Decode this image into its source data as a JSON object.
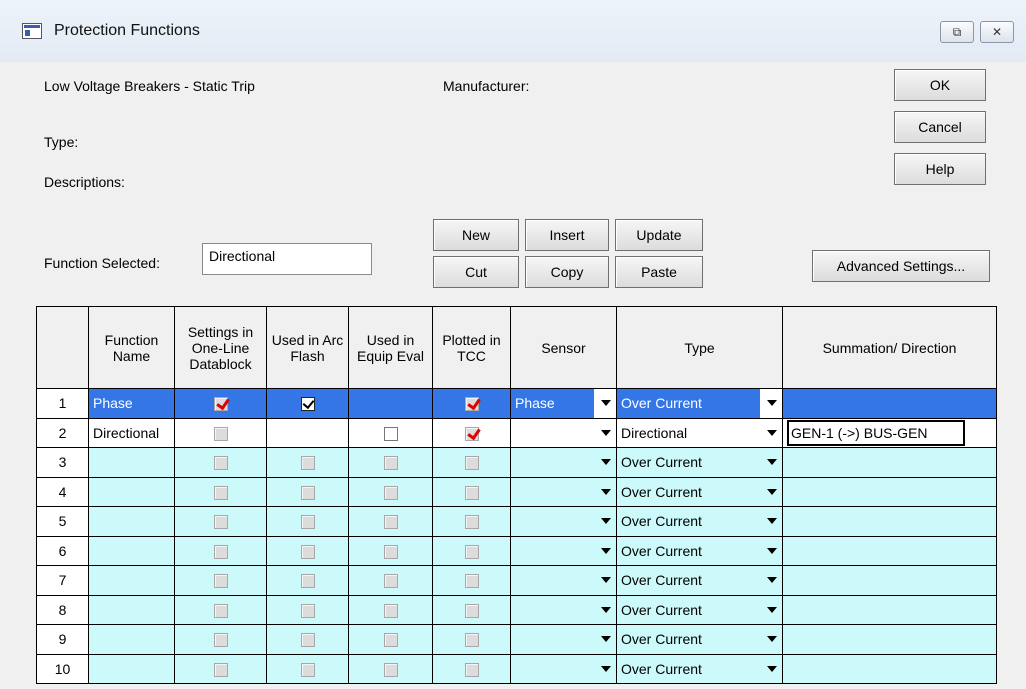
{
  "window": {
    "title": "Protection Functions",
    "restore_glyph": "⧉",
    "close_glyph": "✕"
  },
  "info": {
    "device_type": "Low Voltage Breakers - Static Trip",
    "manufacturer_label": "Manufacturer:",
    "type_label": "Type:",
    "descriptions_label": "Descriptions:",
    "function_selected_label": "Function Selected:",
    "function_selected_value": "Directional"
  },
  "buttons": {
    "ok": "OK",
    "cancel": "Cancel",
    "help": "Help",
    "new": "New",
    "insert": "Insert",
    "update": "Update",
    "cut": "Cut",
    "copy": "Copy",
    "paste": "Paste",
    "advanced": "Advanced Settings..."
  },
  "table": {
    "headers": {
      "function_name": "Function Name",
      "settings": "Settings in One-Line Datablock",
      "arc_flash": "Used in Arc Flash",
      "equip_eval": "Used in Equip Eval",
      "tcc": "Plotted in TCC",
      "sensor": "Sensor",
      "type": "Type",
      "summation": "Summation/ Direction"
    },
    "rows": [
      {
        "num": "1",
        "name": "Phase",
        "sensor": "Phase",
        "type": "Over Current",
        "summation": ""
      },
      {
        "num": "2",
        "name": "Directional",
        "sensor": "",
        "type": "Directional",
        "summation": "GEN-1 (->) BUS-GEN"
      },
      {
        "num": "3",
        "name": "",
        "sensor": "",
        "type": "Over Current",
        "summation": ""
      },
      {
        "num": "4",
        "name": "",
        "sensor": "",
        "type": "Over Current",
        "summation": ""
      },
      {
        "num": "5",
        "name": "",
        "sensor": "",
        "type": "Over Current",
        "summation": ""
      },
      {
        "num": "6",
        "name": "",
        "sensor": "",
        "type": "Over Current",
        "summation": ""
      },
      {
        "num": "7",
        "name": "",
        "sensor": "",
        "type": "Over Current",
        "summation": ""
      },
      {
        "num": "8",
        "name": "",
        "sensor": "",
        "type": "Over Current",
        "summation": ""
      },
      {
        "num": "9",
        "name": "",
        "sensor": "",
        "type": "Over Current",
        "summation": ""
      },
      {
        "num": "10",
        "name": "",
        "sensor": "",
        "type": "Over Current",
        "summation": ""
      }
    ]
  },
  "icons": {
    "window_icon": "window-icon",
    "dropdown": "chevron-down-icon",
    "check_red": "red-check-icon",
    "check_black": "black-check-icon"
  },
  "colors": {
    "selected_row": "#3476e6",
    "empty_row": "#ccf9fa",
    "red_check": "#e00000"
  }
}
